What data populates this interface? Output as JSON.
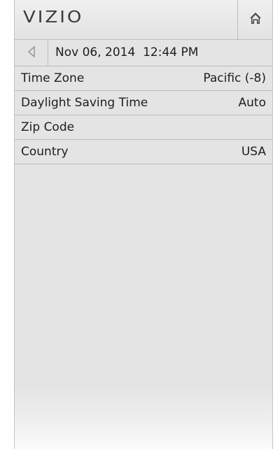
{
  "header": {
    "logo_text": "VIZIO",
    "home_icon": "home-icon"
  },
  "subheader": {
    "back_icon": "back-arrow-icon",
    "datetime": "Nov 06, 2014  12:44 PM"
  },
  "settings": [
    {
      "label": "Time Zone",
      "value": "Pacific (-8)"
    },
    {
      "label": "Daylight Saving Time",
      "value": "Auto"
    },
    {
      "label": "Zip Code",
      "value": ""
    },
    {
      "label": "Country",
      "value": "USA"
    }
  ]
}
